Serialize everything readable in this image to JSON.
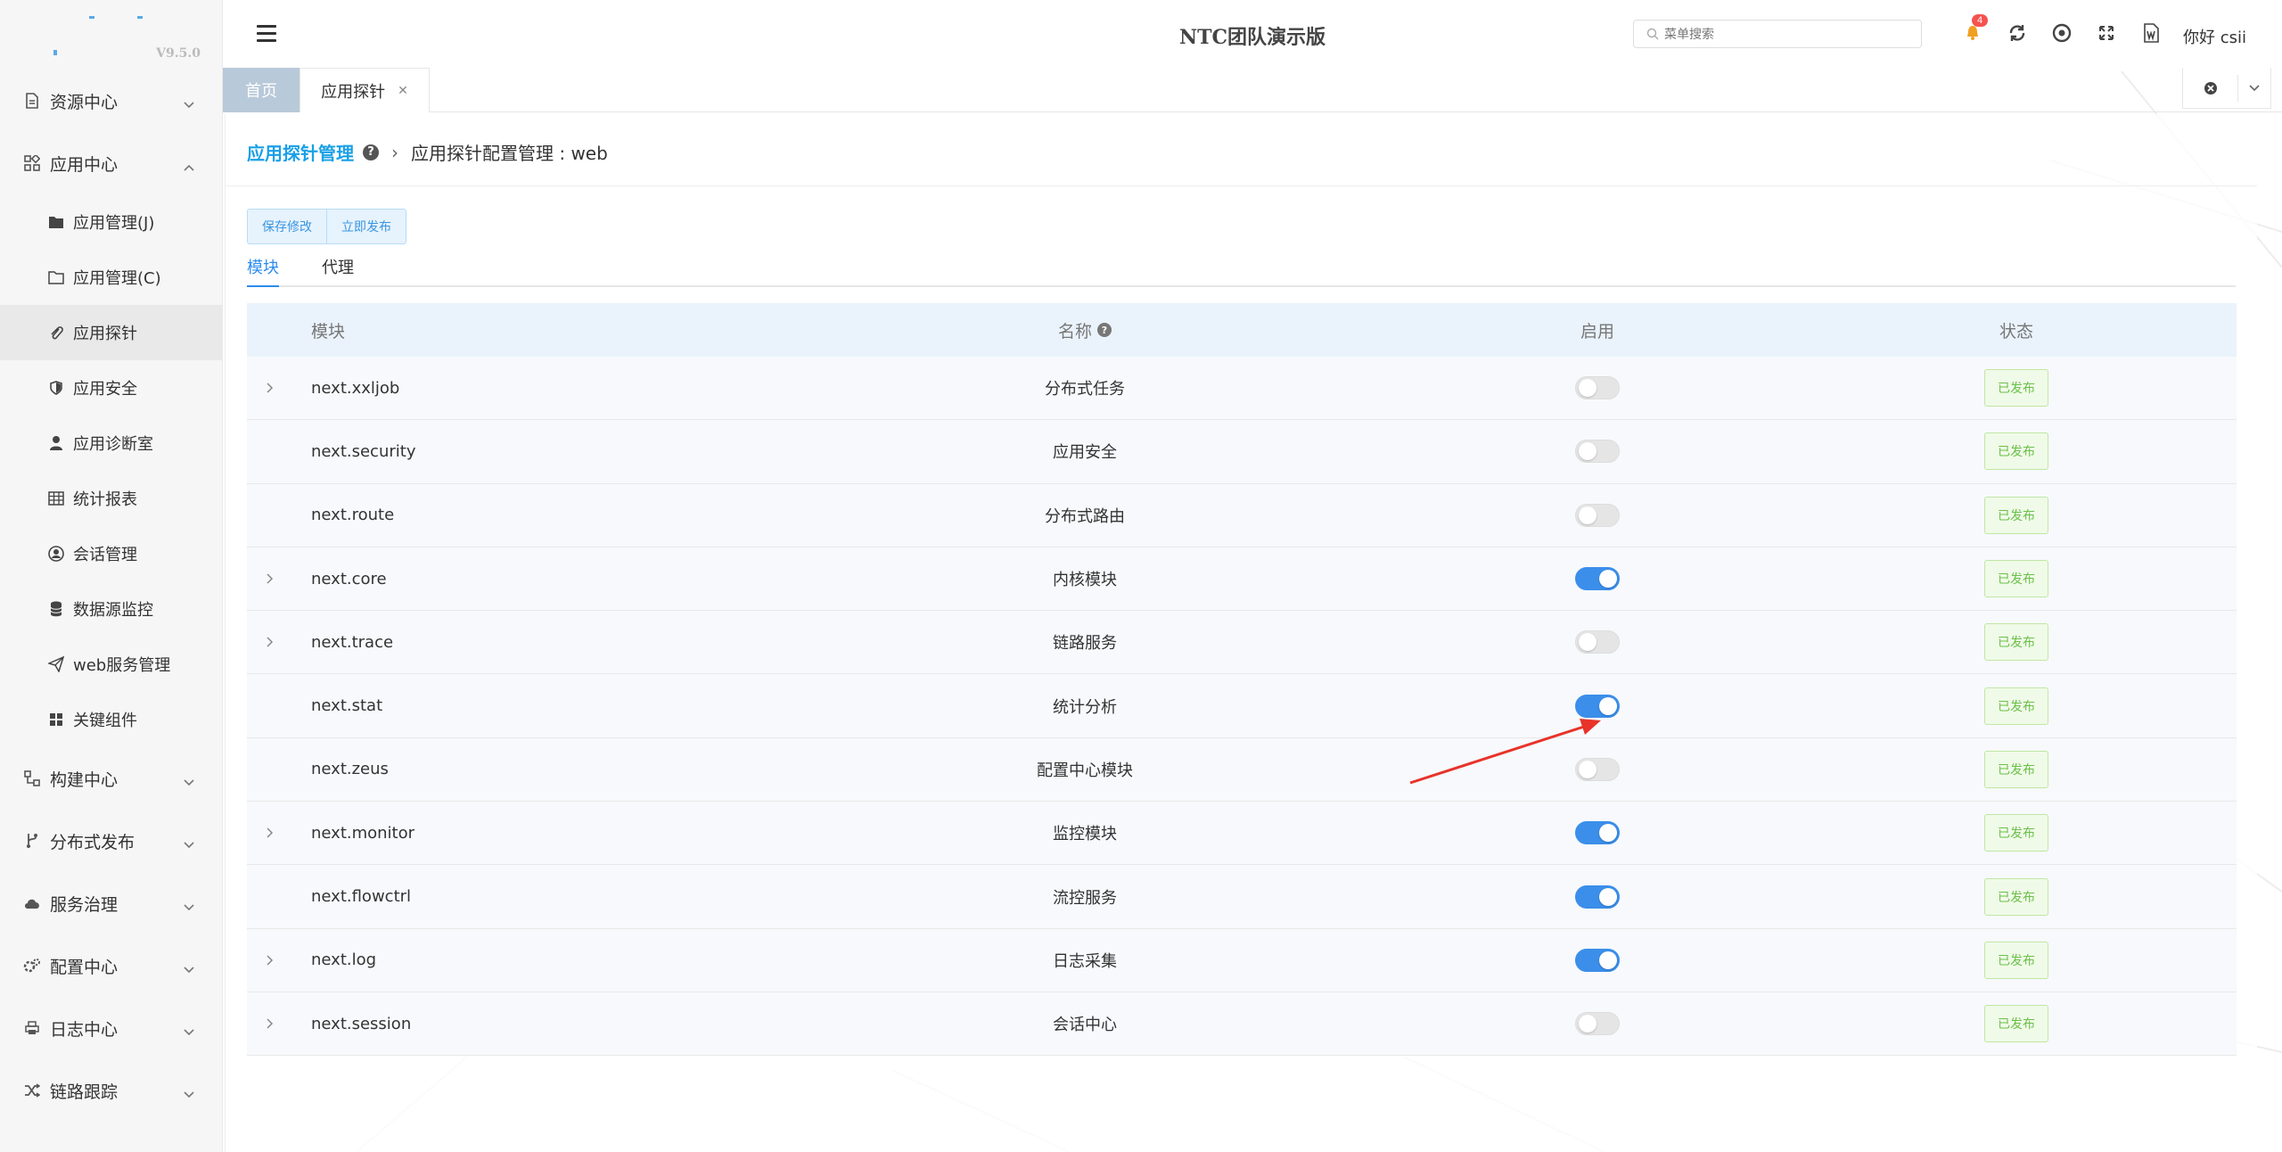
{
  "app": {
    "title": "NTC团队演示版",
    "version": "V9.5.0"
  },
  "header": {
    "search_placeholder": "菜单搜索",
    "notification_count": "4",
    "user_greeting": "你好 csii"
  },
  "sidebar": {
    "groups": [
      {
        "label": "资源中心",
        "icon": "document-icon",
        "expanded": false
      },
      {
        "label": "应用中心",
        "icon": "apps-icon",
        "expanded": true,
        "items": [
          {
            "label": "应用管理(J)",
            "icon": "folder-filled-icon"
          },
          {
            "label": "应用管理(C)",
            "icon": "folder-outline-icon"
          },
          {
            "label": "应用探针",
            "icon": "paperclip-icon",
            "active": true
          },
          {
            "label": "应用安全",
            "icon": "shield-icon"
          },
          {
            "label": "应用诊断室",
            "icon": "user-doctor-icon"
          },
          {
            "label": "统计报表",
            "icon": "table-icon"
          },
          {
            "label": "会话管理",
            "icon": "user-circle-icon"
          },
          {
            "label": "数据源监控",
            "icon": "database-icon"
          },
          {
            "label": "web服务管理",
            "icon": "send-icon"
          },
          {
            "label": "关键组件",
            "icon": "grid-icon"
          }
        ]
      },
      {
        "label": "构建中心",
        "icon": "build-icon",
        "expanded": false
      },
      {
        "label": "分布式发布",
        "icon": "branch-icon",
        "expanded": false
      },
      {
        "label": "服务治理",
        "icon": "cloud-icon",
        "expanded": false
      },
      {
        "label": "配置中心",
        "icon": "cogs-icon",
        "expanded": false
      },
      {
        "label": "日志中心",
        "icon": "printer-icon",
        "expanded": false
      },
      {
        "label": "链路跟踪",
        "icon": "shuffle-icon",
        "expanded": false
      }
    ]
  },
  "tabs": [
    {
      "label": "首页"
    },
    {
      "label": "应用探针",
      "active": true
    }
  ],
  "breadcrumb": {
    "root": "应用探针管理",
    "current": "应用探针配置管理 : web"
  },
  "actions": {
    "save": "保存修改",
    "publish": "立即发布"
  },
  "subtabs": [
    {
      "label": "模块",
      "active": true
    },
    {
      "label": "代理"
    }
  ],
  "table": {
    "headers": {
      "module": "模块",
      "name": "名称",
      "enabled": "启用",
      "status": "状态"
    },
    "rows": [
      {
        "module": "next.xxljob",
        "name": "分布式任务",
        "expandable": true,
        "enabled": false,
        "status": "已发布"
      },
      {
        "module": "next.security",
        "name": "应用安全",
        "expandable": false,
        "enabled": false,
        "status": "已发布"
      },
      {
        "module": "next.route",
        "name": "分布式路由",
        "expandable": false,
        "enabled": false,
        "status": "已发布"
      },
      {
        "module": "next.core",
        "name": "内核模块",
        "expandable": true,
        "enabled": true,
        "status": "已发布"
      },
      {
        "module": "next.trace",
        "name": "链路服务",
        "expandable": true,
        "enabled": false,
        "status": "已发布"
      },
      {
        "module": "next.stat",
        "name": "统计分析",
        "expandable": false,
        "enabled": true,
        "status": "已发布"
      },
      {
        "module": "next.zeus",
        "name": "配置中心模块",
        "expandable": false,
        "enabled": false,
        "status": "已发布"
      },
      {
        "module": "next.monitor",
        "name": "监控模块",
        "expandable": true,
        "enabled": true,
        "status": "已发布"
      },
      {
        "module": "next.flowctrl",
        "name": "流控服务",
        "expandable": false,
        "enabled": true,
        "status": "已发布"
      },
      {
        "module": "next.log",
        "name": "日志采集",
        "expandable": true,
        "enabled": true,
        "status": "已发布"
      },
      {
        "module": "next.session",
        "name": "会话中心",
        "expandable": true,
        "enabled": false,
        "status": "已发布"
      }
    ]
  },
  "colors": {
    "accent": "#3b8eea",
    "link": "#1aa0e6",
    "status_green": "#6bc04a",
    "annotation_arrow": "#e8332a"
  }
}
